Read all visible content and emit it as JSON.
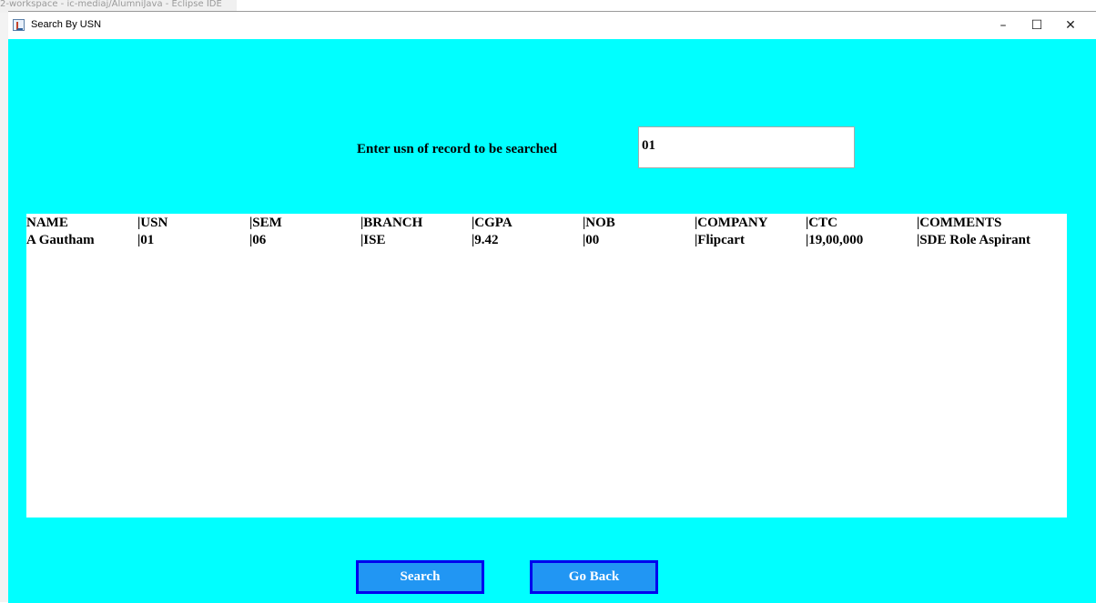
{
  "background_window_title": "2-workspace - ic-mediaj/AlumniJava - Eclipse IDE",
  "window": {
    "title": "Search By USN",
    "minimize": "–",
    "maximize": "☐",
    "close": "✕"
  },
  "form": {
    "prompt": "Enter usn of record to be searched",
    "usn_value": "01"
  },
  "results": {
    "headers": [
      "NAME",
      "|USN",
      "|SEM",
      "|BRANCH",
      "|CGPA",
      "|NOB",
      "|COMPANY",
      "|CTC",
      "|COMMENTS"
    ],
    "rows": [
      [
        "A Gautham",
        "|01",
        "|06",
        "|ISE",
        "|9.42",
        "|00",
        "|Flipcart",
        "|19,00,000",
        "|SDE Role Aspirant"
      ]
    ]
  },
  "buttons": {
    "search": "Search",
    "go_back": "Go Back"
  },
  "colors": {
    "window_background": "#00ffff",
    "button_fill": "#2196f3",
    "button_border": "#0000ee"
  }
}
